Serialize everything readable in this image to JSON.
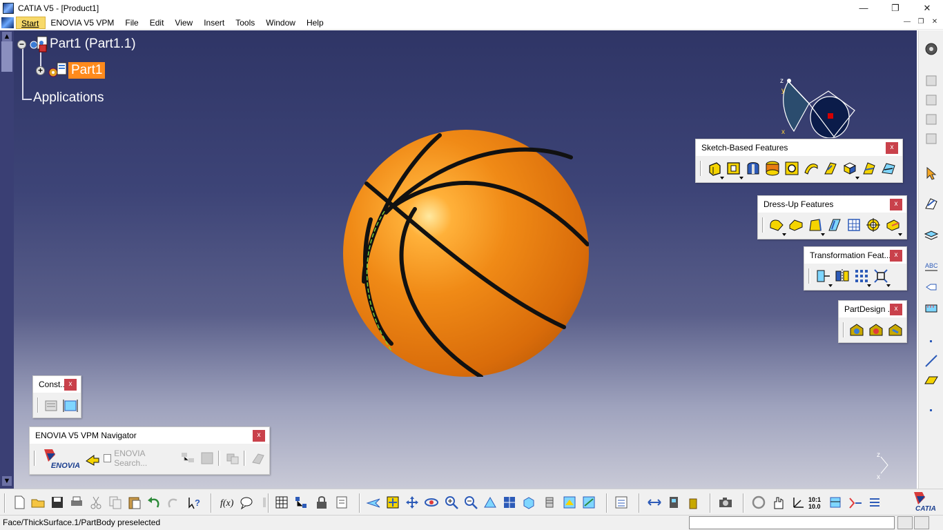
{
  "window": {
    "title": "CATIA V5 - [Product1]",
    "minimize": "—",
    "maximize": "❐",
    "close": "✕"
  },
  "menu": {
    "items": [
      "Start",
      "ENOVIA V5 VPM",
      "File",
      "Edit",
      "View",
      "Insert",
      "Tools",
      "Window",
      "Help"
    ],
    "mdi": [
      "—",
      "❐",
      "✕"
    ]
  },
  "tree": {
    "root": "Part1 (Part1.1)",
    "child": "Part1",
    "applications": "Applications"
  },
  "compass": {
    "z": "z",
    "y": "y",
    "x": "x"
  },
  "toolbars": {
    "sketch_based": {
      "title": "Sketch-Based Features",
      "close": "x"
    },
    "dress_up": {
      "title": "Dress-Up Features",
      "close": "x"
    },
    "transformation": {
      "title": "Transformation Feat...",
      "close": "x"
    },
    "partdesign": {
      "title": "PartDesign ...",
      "close": "x"
    },
    "constraints": {
      "title": "Const...",
      "close": "x"
    },
    "enovia_nav": {
      "title": "ENOVIA V5 VPM Navigator",
      "close": "x",
      "logo": "ENOVIA",
      "search": "ENOVIA Search..."
    }
  },
  "mini_axis": {
    "z": "z",
    "x": "x"
  },
  "catia_logo": "CATIA",
  "status": {
    "message": "Face/ThickSurface.1/PartBody preselected",
    "input_value": ""
  },
  "colors": {
    "viewport_top": "#2f3566",
    "selection_orange": "#ff8a1c",
    "close_red": "#c9414b"
  }
}
